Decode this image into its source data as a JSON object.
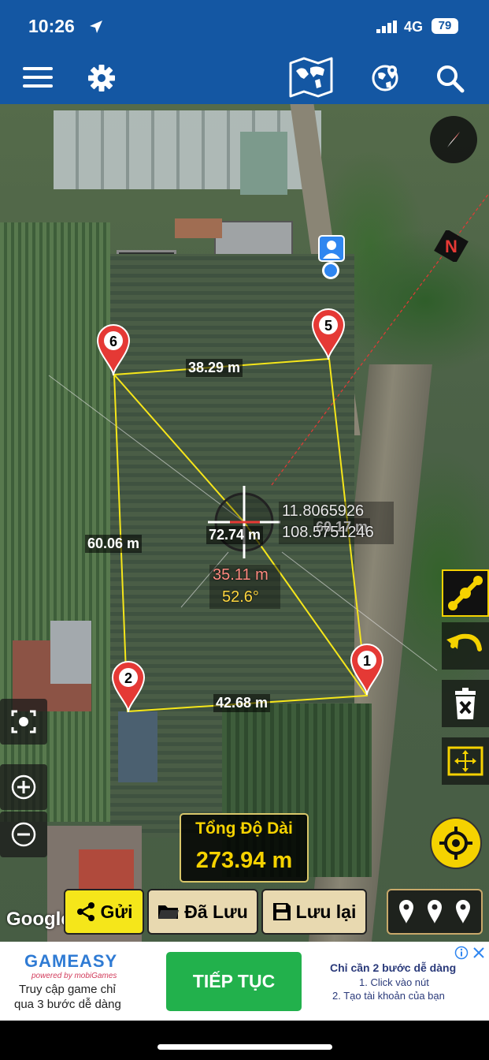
{
  "status_bar": {
    "time": "10:26",
    "network": "4G",
    "battery": "79"
  },
  "app_bar": {
    "menu_icon": "hamburger-menu-icon",
    "settings_icon": "gear-icon",
    "map_type_icon": "world-map-icon",
    "globe_icon": "globe-pin-icon",
    "search_icon": "search-icon",
    "color": "#1457a3"
  },
  "map": {
    "pins": [
      {
        "number": "1"
      },
      {
        "number": "2"
      },
      {
        "number": "5"
      },
      {
        "number": "6"
      }
    ],
    "edge_labels": {
      "top": "38.29 m",
      "left": "60.06 m",
      "right": "60.17 m",
      "bottom": "42.68 m",
      "diagonal": "72.74 m"
    },
    "cursor": {
      "lat": "11.8065926",
      "lon": "108.5751246",
      "distance": "35.11 m",
      "angle": "52.6°"
    },
    "total": {
      "label": "Tổng Độ Dài",
      "value": "273.94 m"
    },
    "attribution": "Google",
    "polygon_color": "#f5e61a"
  },
  "controls": {
    "send_label": "Gửi",
    "saved_label": "Đã Lưu",
    "save_label": "Lưu lại"
  },
  "ad": {
    "brand": "GAMEASY",
    "powered_by": "powered by mobiGames",
    "tagline_line1": "Truy cập game chỉ",
    "tagline_line2": "qua 3 bước dễ dàng",
    "cta": "TIẾP TỤC",
    "right_title": "Chỉ cần 2 bước dễ dàng",
    "right_step1": "1. Click vào nút",
    "right_step2": "2. Tạo tài khoản của bạn"
  }
}
